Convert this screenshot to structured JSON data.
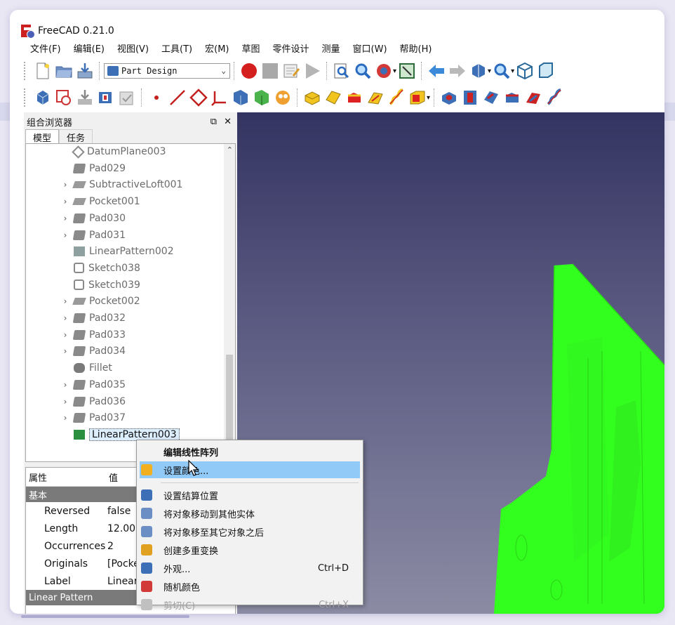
{
  "window": {
    "title": "FreeCAD 0.21.0"
  },
  "menu": [
    "文件(F)",
    "编辑(E)",
    "视图(V)",
    "工具(T)",
    "宏(M)",
    "草图",
    "零件设计",
    "测量",
    "窗口(W)",
    "帮助(H)"
  ],
  "toolbar": {
    "workbench": "Part Design"
  },
  "combo_view": {
    "title": "组合浏览器",
    "tabs": [
      "模型",
      "任务"
    ],
    "tree": [
      {
        "label": "DatumPlane003",
        "icon": "plane",
        "expand": false
      },
      {
        "label": "Pad029",
        "icon": "pad",
        "expand": false
      },
      {
        "label": "SubtractiveLoft001",
        "icon": "pocket",
        "expand": true
      },
      {
        "label": "Pocket001",
        "icon": "pocket",
        "expand": true
      },
      {
        "label": "Pad030",
        "icon": "pad",
        "expand": true
      },
      {
        "label": "Pad031",
        "icon": "pad",
        "expand": true
      },
      {
        "label": "LinearPattern002",
        "icon": "pattern",
        "expand": false
      },
      {
        "label": "Sketch038",
        "icon": "sketch",
        "expand": false
      },
      {
        "label": "Sketch039",
        "icon": "sketch",
        "expand": false
      },
      {
        "label": "Pocket002",
        "icon": "pocket",
        "expand": true
      },
      {
        "label": "Pad032",
        "icon": "pad",
        "expand": true
      },
      {
        "label": "Pad033",
        "icon": "pad",
        "expand": true
      },
      {
        "label": "Pad034",
        "icon": "pad",
        "expand": true
      },
      {
        "label": "Fillet",
        "icon": "fillet",
        "expand": false
      },
      {
        "label": "Pad035",
        "icon": "pad",
        "expand": true
      },
      {
        "label": "Pad036",
        "icon": "pad",
        "expand": true
      },
      {
        "label": "Pad037",
        "icon": "pad",
        "expand": true
      },
      {
        "label": "LinearPattern003",
        "icon": "pattern",
        "expand": false,
        "selected": true
      }
    ]
  },
  "properties": {
    "col_prop": "属性",
    "col_val": "值",
    "group_basic": "基本",
    "rows": [
      {
        "name": "Reversed",
        "value": "false"
      },
      {
        "name": "Length",
        "value": "12.000"
      },
      {
        "name": "Occurrences",
        "value": "2"
      },
      {
        "name": "Originals",
        "value": "[Pocke"
      },
      {
        "name": "Label",
        "value": "Linear"
      }
    ],
    "group_pattern": "Linear Pattern"
  },
  "context_menu": [
    {
      "label": "编辑线性阵列",
      "bold": true,
      "icon": "none"
    },
    {
      "label": "设置颜色...",
      "highlight": true,
      "icon": "color-cube-icon"
    },
    {
      "sep": true
    },
    {
      "label": "设置结算位置",
      "icon": "tip-icon"
    },
    {
      "label": "将对象移动到其他实体",
      "icon": "move-body-icon"
    },
    {
      "label": "将对象移至其它对象之后",
      "icon": "move-after-icon"
    },
    {
      "label": "创建多重变换",
      "icon": "multitransform-icon"
    },
    {
      "label": "外观...",
      "shortcut": "Ctrl+D",
      "icon": "appearance-icon"
    },
    {
      "label": "随机颜色",
      "icon": "random-color-icon"
    },
    {
      "label": "剪切(C)",
      "shortcut": "Ctrl+X",
      "dim": true,
      "icon": "cut-icon"
    }
  ],
  "colors": {
    "model": "#33ff1f",
    "viewport_top": "#343462",
    "viewport_bottom": "#8b8ba4",
    "highlight": "#91c9f7"
  }
}
